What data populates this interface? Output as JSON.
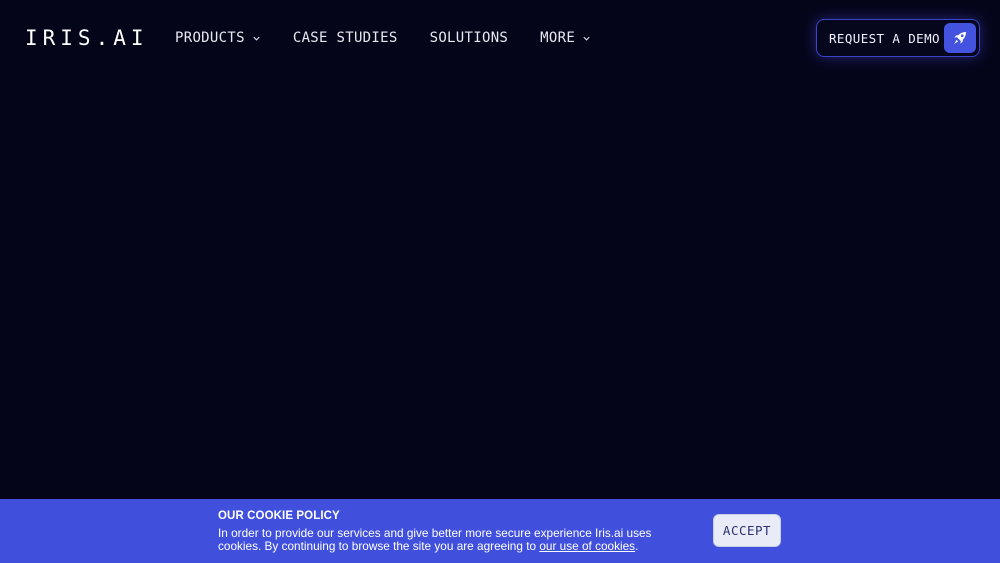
{
  "header": {
    "logo": "IRIS.AI",
    "nav": [
      {
        "label": "PRODUCTS",
        "has_dropdown": true
      },
      {
        "label": "CASE STUDIES",
        "has_dropdown": false
      },
      {
        "label": "SOLUTIONS",
        "has_dropdown": false
      },
      {
        "label": "MORE",
        "has_dropdown": true
      }
    ],
    "cta": {
      "label": "REQUEST A DEMO",
      "icon": "rocket-icon"
    }
  },
  "cookie": {
    "title": "OUR COOKIE POLICY",
    "text_before_link": "In order to provide our services and give better more secure experience Iris.ai uses cookies. By continuing to browse the site you are agreeing to ",
    "link_text": "our use of cookies",
    "text_after_link": ".",
    "accept_label": "ACCEPT"
  },
  "colors": {
    "background": "#05051a",
    "accent": "#4353e0",
    "cookie_bar": "#4150dc"
  }
}
